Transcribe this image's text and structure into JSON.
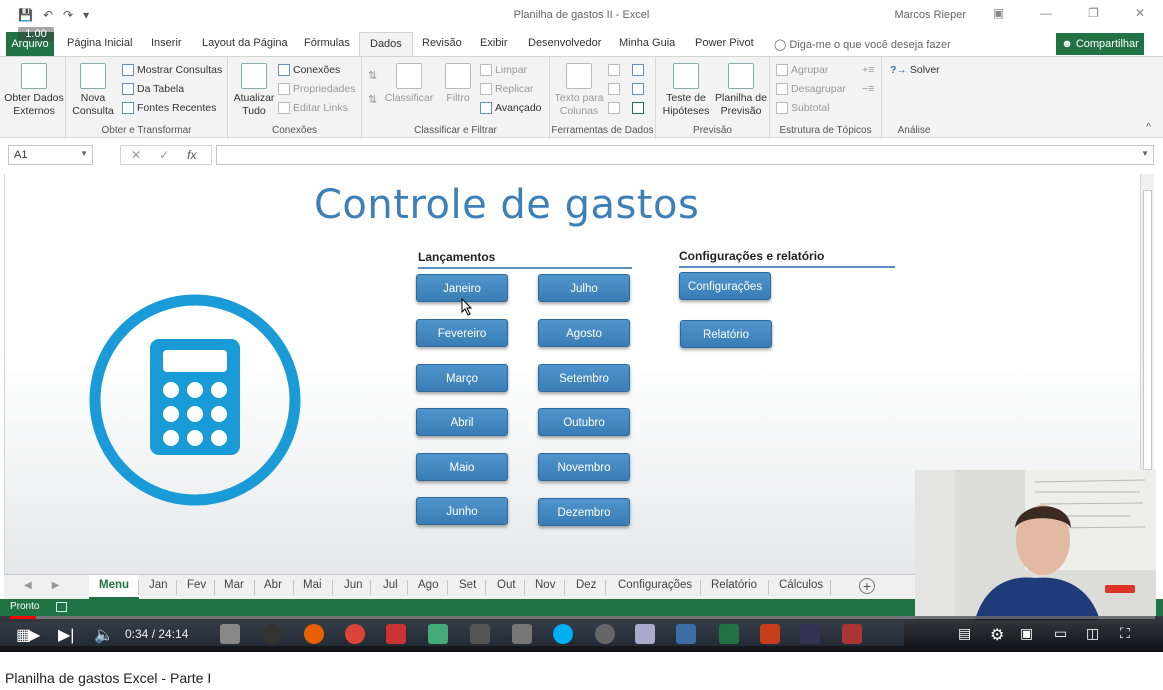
{
  "window": {
    "doc_title": "Planilha de gastos II  -  Excel",
    "user": "Marcos Rieper",
    "share_label": "Compartilhar",
    "overlay_badge": "1.00"
  },
  "ribbon_tabs": {
    "file": "Arquivo",
    "items": [
      "Página Inicial",
      "Inserir",
      "Layout da Página",
      "Fórmulas",
      "Dados",
      "Revisão",
      "Exibir",
      "Desenvolvedor",
      "Minha Guia",
      "Power Pivot"
    ],
    "active": "Dados",
    "tell_me": "Diga-me o que você deseja fazer"
  },
  "ribbon": {
    "get_external": "Obter Dados Externos",
    "get_external_l1": "Obter Dados",
    "get_external_l2": "Externos",
    "new_query_l1": "Nova",
    "new_query_l2": "Consulta",
    "show_queries": "Mostrar Consultas",
    "from_table": "Da Tabela",
    "recent_sources": "Fontes Recentes",
    "group_get_transform": "Obter e Transformar",
    "refresh_l1": "Atualizar",
    "refresh_l2": "Tudo",
    "connections": "Conexões",
    "properties": "Propriedades",
    "edit_links": "Editar Links",
    "group_connections": "Conexões",
    "sort": "Classificar",
    "filter": "Filtro",
    "clear": "Limpar",
    "reapply": "Replicar",
    "advanced": "Avançado",
    "group_sort_filter": "Classificar e Filtrar",
    "text_to_columns_l1": "Texto para",
    "text_to_columns_l2": "Colunas",
    "group_data_tools": "Ferramentas de Dados",
    "whatif_l1": "Teste de",
    "whatif_l2": "Hipóteses",
    "forecast_l1": "Planilha de",
    "forecast_l2": "Previsão",
    "group_forecast": "Previsão",
    "group_btn": "Agrupar",
    "ungroup_btn": "Desagrupar",
    "subtotal": "Subtotal",
    "group_outline": "Estrutura de Tópicos",
    "solver": "Solver",
    "group_analysis": "Análise"
  },
  "formula_bar": {
    "name_box": "A1",
    "fx": "fx",
    "value": ""
  },
  "sheet": {
    "title": "Controle de gastos",
    "launches_header": "Lançamentos",
    "config_header": "Configurações e relatório",
    "months_left": [
      "Janeiro",
      "Fevereiro",
      "Março",
      "Abril",
      "Maio",
      "Junho"
    ],
    "months_right": [
      "Julho",
      "Agosto",
      "Setembro",
      "Outubro",
      "Novembro",
      "Dezembro"
    ],
    "config_button": "Configurações",
    "report_button": "Relatório"
  },
  "sheet_tabs": [
    "Menu",
    "Jan",
    "Fev",
    "Mar",
    "Abr",
    "Mai",
    "Jun",
    "Jul",
    "Ago",
    "Set",
    "Out",
    "Nov",
    "Dez",
    "Configurações",
    "Relatório",
    "Cálculos"
  ],
  "active_sheet": "Menu",
  "status": {
    "ready": "Pronto"
  },
  "video": {
    "time": "0:34 / 24:14",
    "progress": 0.023,
    "caption": "Planilha de gastos Excel - Parte I"
  },
  "colors": {
    "excel_green": "#217346",
    "title_blue": "#3d7fb8",
    "button_blue": "#3f87c0",
    "calc_blue": "#1a9ad6"
  }
}
